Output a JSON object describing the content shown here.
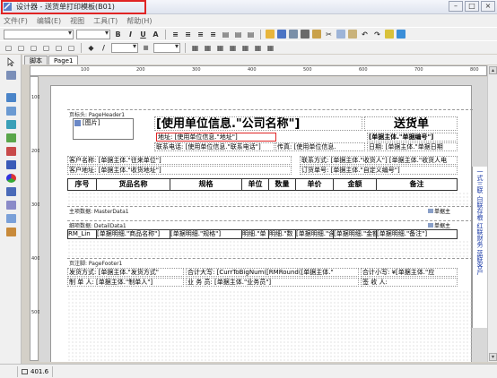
{
  "window": {
    "title": "设计器 - 送货单打印模板(B01)",
    "buttons": [
      "–",
      "□",
      "×"
    ]
  },
  "menu": [
    "文件(F)",
    "编辑(E)",
    "视图",
    "工具(T)",
    "帮助(H)"
  ],
  "tabs": [
    "脚本",
    "Page1"
  ],
  "ruler": {
    "marks": [
      "100",
      "200",
      "300",
      "400",
      "500",
      "600",
      "700",
      "800"
    ]
  },
  "bands": {
    "page_header": "页标头: PageHeader1",
    "master": "主项数据: MasterData1",
    "detail": "细项数据: DetailData1",
    "footer": "页注脚: PageFooter1"
  },
  "header": {
    "image_label": "[图片]",
    "company_name": "[使用单位信息.\"公司名称\"]",
    "doc_title": "送货单",
    "address": "地址: [使用单位信息.\"地址\"]",
    "doc_no": "[单据主体.\"单据编号\"]",
    "contact_tel": "联系电话: [使用单位信息.\"联系电话\"]",
    "fax": "传真: [使用单位信息.",
    "date": "日期: [单据主体.\"单据日期",
    "customer_name": "客户名称: [单据主体.\"往来单位\"]",
    "contact": "联系方式: [单据主体.\"收货人\"] [单据主体.\"收货人电",
    "customer_addr": "客户地址: [单据主体.\"收货地址\"]",
    "order_no": "订货单号: [单据主体.\"自定义编号\"]"
  },
  "table_headers": [
    "序号",
    "货品名称",
    "规格",
    "单位",
    "数量",
    "单价",
    "金额",
    "备注"
  ],
  "master_field": "单据主",
  "detail_fields": [
    "RM_Lin",
    "[单据明细.\"商品名称\"]",
    "[单据明细.\"规格\"]",
    "明细.\"单",
    "明细.\"数",
    "[单据明细.\"含税",
    "[单据明细.\"金额",
    "[单据明细.\"备注\"]"
  ],
  "detail_right": "单据主",
  "footer": {
    "ship_method": "发货方式: [单据主体.\"发货方式\"",
    "total_upper": "合计大写: [CurrToBigNum([RMRound([单据主体.\"",
    "total_lower": "合计小写: ¥[单据主体.\"应",
    "maker": "制 单 人: [单据主体.\"制单人\"]",
    "salesman": "业 务 员: [单据主体.\"业务员\"]",
    "receiver": "签 收 人:"
  },
  "side_text": "一式三联  白联存根  红联财务  蓝联客户",
  "status": {
    "position": "401.6"
  }
}
